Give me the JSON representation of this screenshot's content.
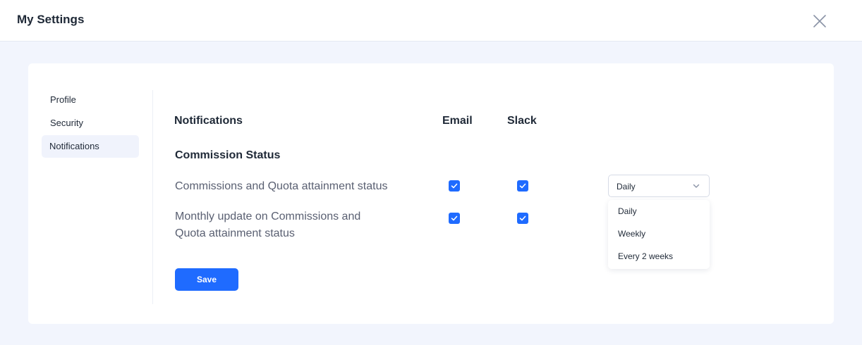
{
  "header": {
    "title": "My Settings",
    "close_icon": "close-icon"
  },
  "sidebar": {
    "items": [
      {
        "label": "Profile",
        "active": false
      },
      {
        "label": "Security",
        "active": false
      },
      {
        "label": "Notifications",
        "active": true
      }
    ]
  },
  "main": {
    "columns": {
      "notifications": "Notifications",
      "email": "Email",
      "slack": "Slack"
    },
    "section_title": "Commission Status",
    "rows": [
      {
        "label": "Commissions and Quota attainment status",
        "email_checked": true,
        "slack_checked": true,
        "frequency": "Daily"
      },
      {
        "label_line1": "Monthly update on Commissions and",
        "label_line2": "Quota attainment status",
        "email_checked": true,
        "slack_checked": true
      }
    ],
    "frequency_select": {
      "selected": "Daily",
      "options": [
        "Daily",
        "Weekly",
        "Every 2 weeks"
      ]
    },
    "save_label": "Save"
  },
  "colors": {
    "accent": "#1f6bff",
    "background": "#f2f5fd",
    "active_nav": "#f0f3fc"
  }
}
